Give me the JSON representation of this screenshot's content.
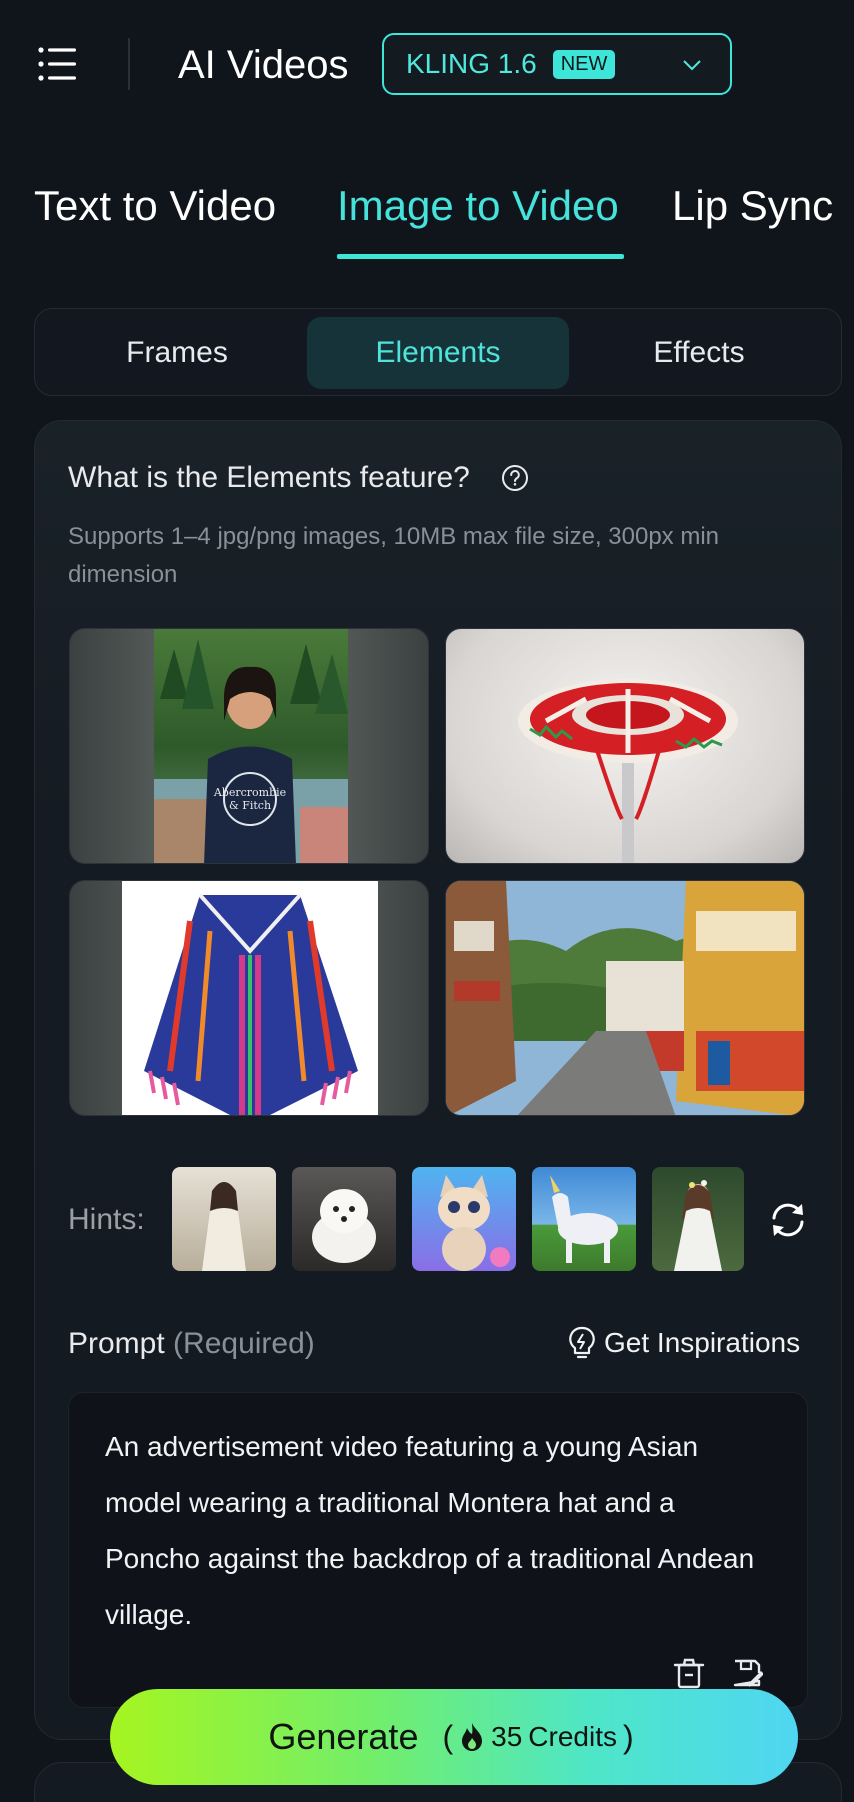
{
  "header": {
    "menu_icon": "hamburger-menu-icon",
    "title": "AI Videos",
    "model": {
      "name": "KLING 1.6",
      "badge": "NEW",
      "chevron_icon": "chevron-down-icon"
    },
    "accent_color": "#3ee6da"
  },
  "main_tabs": [
    {
      "label": "Text to Video",
      "active": false
    },
    {
      "label": "Image to Video",
      "active": true
    },
    {
      "label": "Lip Sync",
      "active": false
    }
  ],
  "sub_tabs": [
    {
      "label": "Frames",
      "active": false
    },
    {
      "label": "Elements",
      "active": true
    },
    {
      "label": "Effects",
      "active": false
    }
  ],
  "elements": {
    "title": "What is the Elements feature?",
    "help_icon": "question-circle-icon",
    "description": "Supports 1–4 jpg/png images, 10MB max file size, 300px min dimension",
    "images": [
      {
        "subject": "young woman portrait",
        "shirt_text": "Abercrombie & Fitch"
      },
      {
        "subject": "traditional montera hat"
      },
      {
        "subject": "striped poncho"
      },
      {
        "subject": "andean village street"
      }
    ]
  },
  "hints": {
    "label": "Hints:",
    "thumbnails": [
      "woman-in-dress",
      "white-puppy",
      "cartoon-kitten",
      "unicorn",
      "forest-woman"
    ],
    "refresh_icon": "refresh-icon"
  },
  "prompt": {
    "label": "Prompt",
    "required_label": "(Required)",
    "inspirations_label": "Get Inspirations",
    "inspirations_icon": "lightbulb-icon",
    "text": "An advertisement video featuring a young Asian model wearing a traditional Montera hat and a Poncho against the backdrop of a traditional Andean village.",
    "trash_icon": "trash-icon",
    "save_icon": "save-draft-icon"
  },
  "generate": {
    "label": "Generate",
    "credits_open": "(",
    "credits_close": ")",
    "credits_value": "35",
    "credits_word": "Credits",
    "credits_icon": "flame-icon"
  }
}
